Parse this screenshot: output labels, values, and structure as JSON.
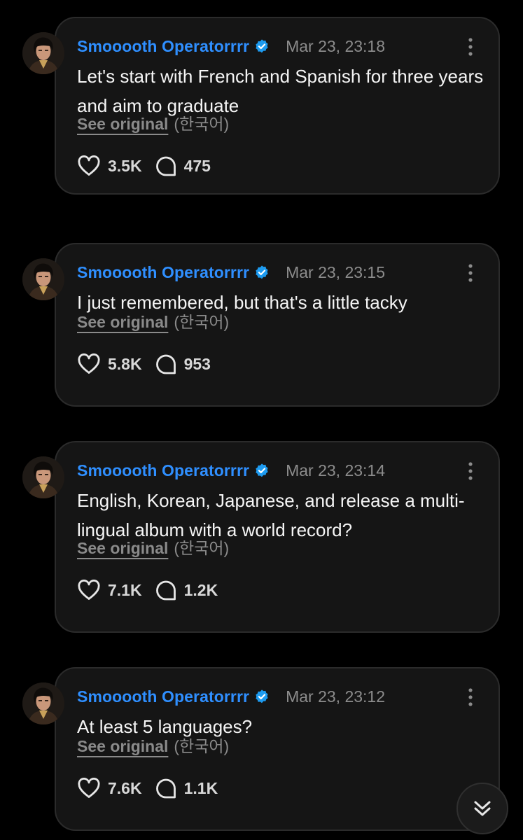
{
  "posts": [
    {
      "username": "Smooooth Operatorrrr",
      "timestamp": "Mar 23, 23:18",
      "text": "Let's start with French and Spanish for three years and aim to graduate",
      "see_original": "See original",
      "original_language": "(한국어)",
      "likes": "3.5K",
      "replies": "475"
    },
    {
      "username": "Smooooth Operatorrrr",
      "timestamp": "Mar 23, 23:15",
      "text": "I just remembered, but that's a little tacky",
      "see_original": "See original",
      "original_language": "(한국어)",
      "likes": "5.8K",
      "replies": "953"
    },
    {
      "username": "Smooooth Operatorrrr",
      "timestamp": "Mar 23, 23:14",
      "text": "English, Korean, Japanese, and release a multi-lingual album with a world record?",
      "see_original": "See original",
      "original_language": "(한국어)",
      "likes": "7.1K",
      "replies": "1.2K"
    },
    {
      "username": "Smooooth Operatorrrr",
      "timestamp": "Mar 23, 23:12",
      "text": "At least 5 languages?",
      "see_original": "See original",
      "original_language": "(한국어)",
      "likes": "7.6K",
      "replies": "1.1K"
    }
  ],
  "icons": {
    "verified": "verified-badge-icon",
    "more": "more-vertical-icon",
    "like": "heart-icon",
    "reply": "speech-bubble-icon",
    "scroll": "double-chevron-down-icon"
  },
  "colors": {
    "background": "#000000",
    "card": "#151515",
    "username": "#2f8fff",
    "verified_badge": "#1d9bf0",
    "muted_text": "#8c8c8c"
  }
}
